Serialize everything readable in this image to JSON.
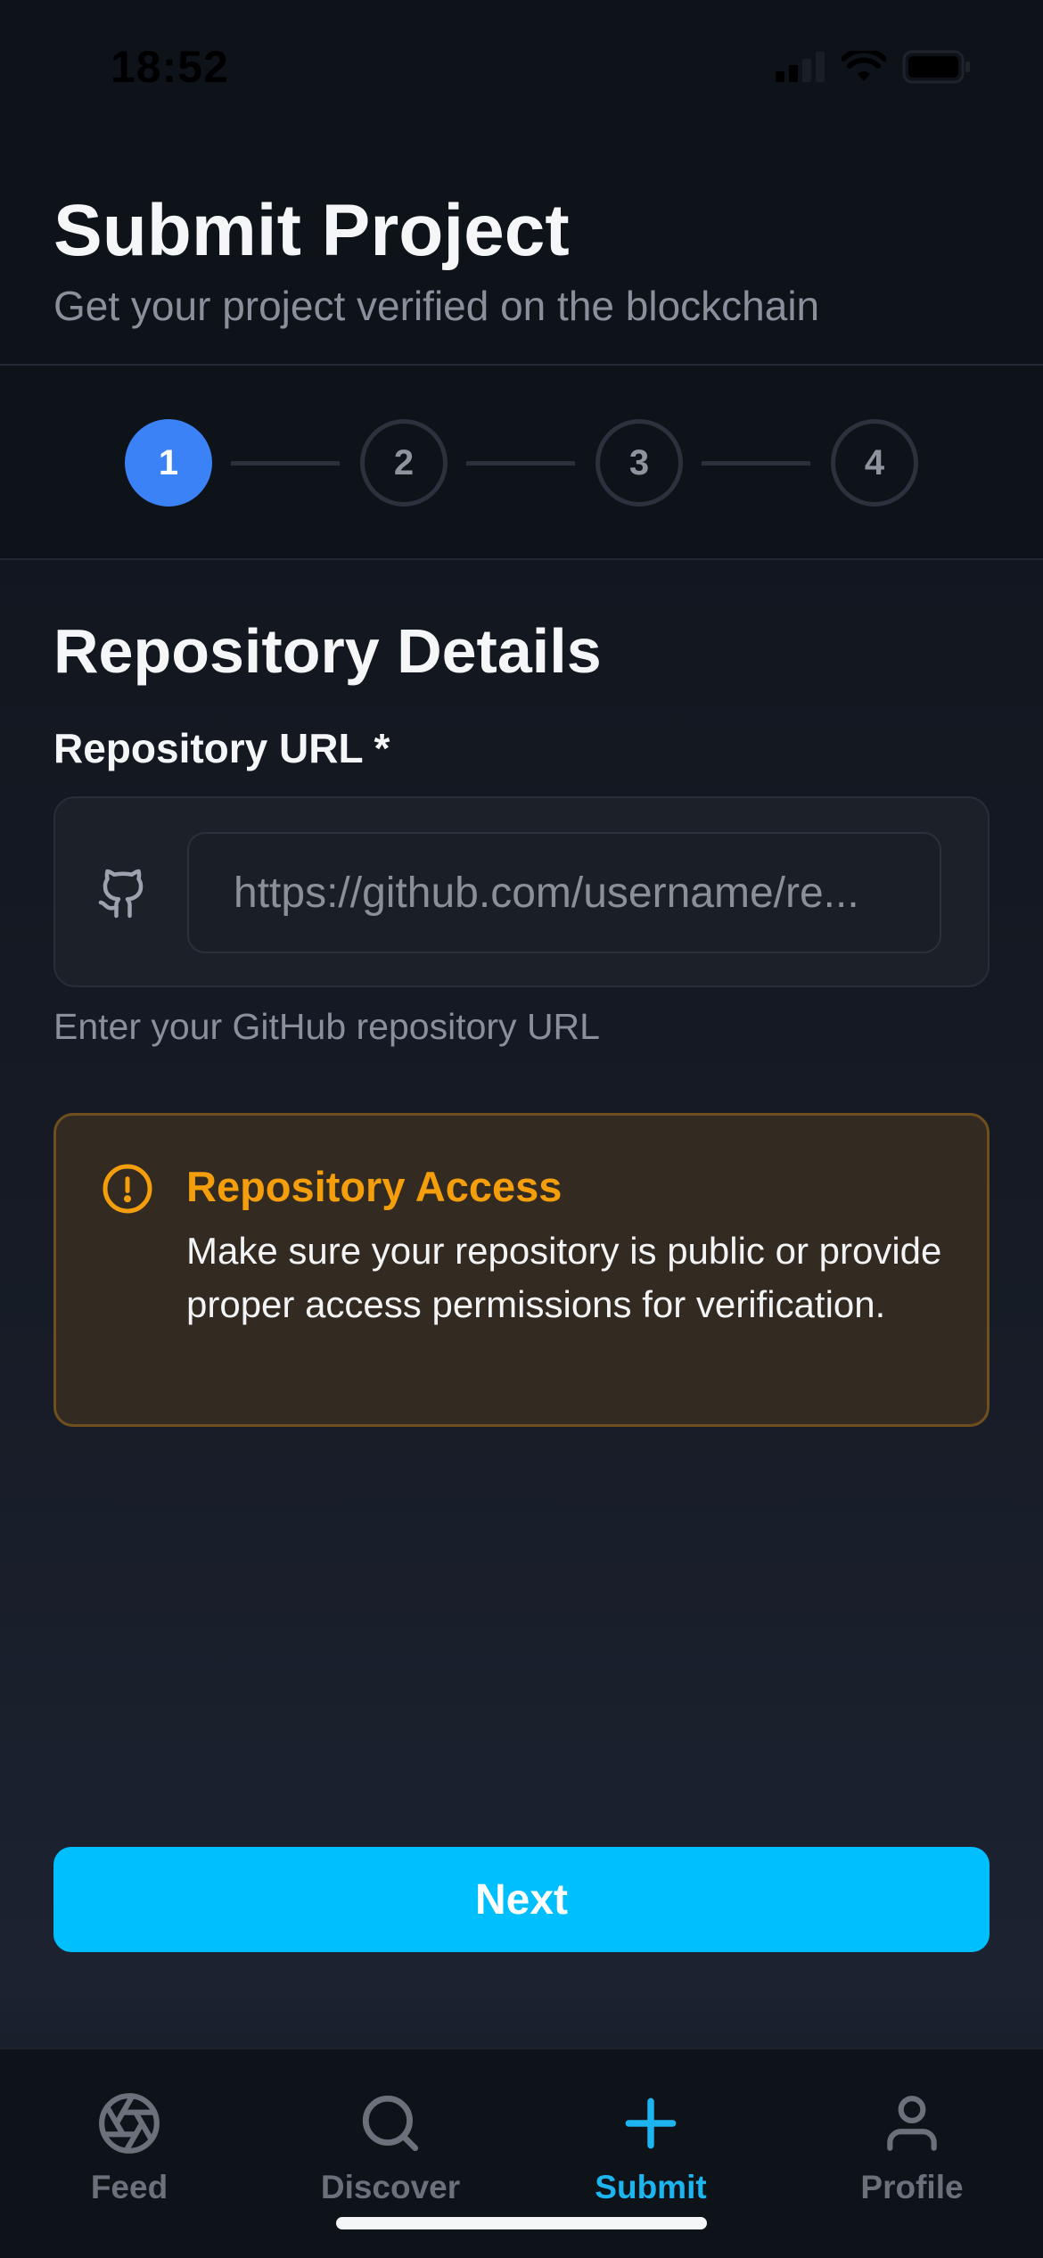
{
  "status_bar": {
    "time": "18:52",
    "icons": [
      "signal-icon",
      "wifi-icon",
      "battery-icon"
    ]
  },
  "header": {
    "title": "Submit Project",
    "subtitle": "Get your project verified on the blockchain"
  },
  "stepper": {
    "steps": [
      "1",
      "2",
      "3",
      "4"
    ],
    "active_step": 1
  },
  "form": {
    "section_title": "Repository Details",
    "repo_label": "Repository URL *",
    "repo_input": {
      "value": "",
      "placeholder": "https://github.com/username/re..."
    },
    "repo_icon": "github-icon",
    "helper": "Enter your GitHub repository URL"
  },
  "notice": {
    "icon": "alert-circle-icon",
    "title": "Repository Access",
    "body": "Make sure your repository is public or provide proper access permissions for verification."
  },
  "actions": {
    "next_label": "Next"
  },
  "tab_bar": {
    "tabs": [
      {
        "label": "Feed",
        "icon": "aperture-icon"
      },
      {
        "label": "Discover",
        "icon": "search-icon"
      },
      {
        "label": "Submit",
        "icon": "plus-icon"
      },
      {
        "label": "Profile",
        "icon": "user-icon"
      }
    ],
    "active": "Submit"
  },
  "colors": {
    "accent": "#00bfff",
    "step_active": "#3b82f6",
    "warning": "#f59e0b",
    "background": "#0f131b"
  }
}
